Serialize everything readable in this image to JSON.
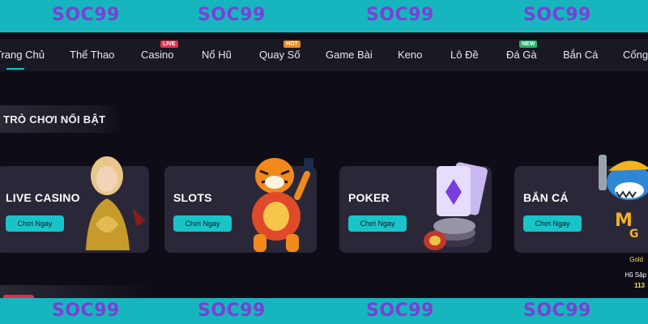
{
  "watermark": "SOC99",
  "nav": {
    "items": [
      {
        "label": "Trang Chủ",
        "badge": null
      },
      {
        "label": "Thể Thao",
        "badge": null
      },
      {
        "label": "Casino",
        "badge": "LIVE"
      },
      {
        "label": "Nổ Hũ",
        "badge": null
      },
      {
        "label": "Quay Số",
        "badge": "HOT"
      },
      {
        "label": "Game Bài",
        "badge": null
      },
      {
        "label": "Keno",
        "badge": null
      },
      {
        "label": "Lô Đề",
        "badge": null
      },
      {
        "label": "Đá Gà",
        "badge": "NEW"
      },
      {
        "label": "Bắn Cá",
        "badge": null
      },
      {
        "label": "Cổng",
        "badge": null
      }
    ]
  },
  "section": {
    "title": "TRÒ CHƠI NỔI BẬT"
  },
  "cards": [
    {
      "name": "LIVE CASINO",
      "button": "Chơi Ngay",
      "icon": "live-dealer-image"
    },
    {
      "name": "SLOTS",
      "button": "Chơi Ngay",
      "icon": "tiger-mascot-image"
    },
    {
      "name": "POKER",
      "button": "Chơi Ngay",
      "icon": "cards-and-chips-image"
    },
    {
      "name": "BẮN CÁ",
      "button": "Chơi Ngay",
      "icon": "shark-mascot-image"
    }
  ],
  "promo": {
    "line1": "Gold",
    "line2": "Hũ Sập",
    "line3": "113"
  },
  "colors": {
    "accent": "#19c4c9",
    "band": "#17b6bf",
    "watermark": "#7c3fd6",
    "background": "#0e0c16",
    "card": "#2a2838"
  }
}
